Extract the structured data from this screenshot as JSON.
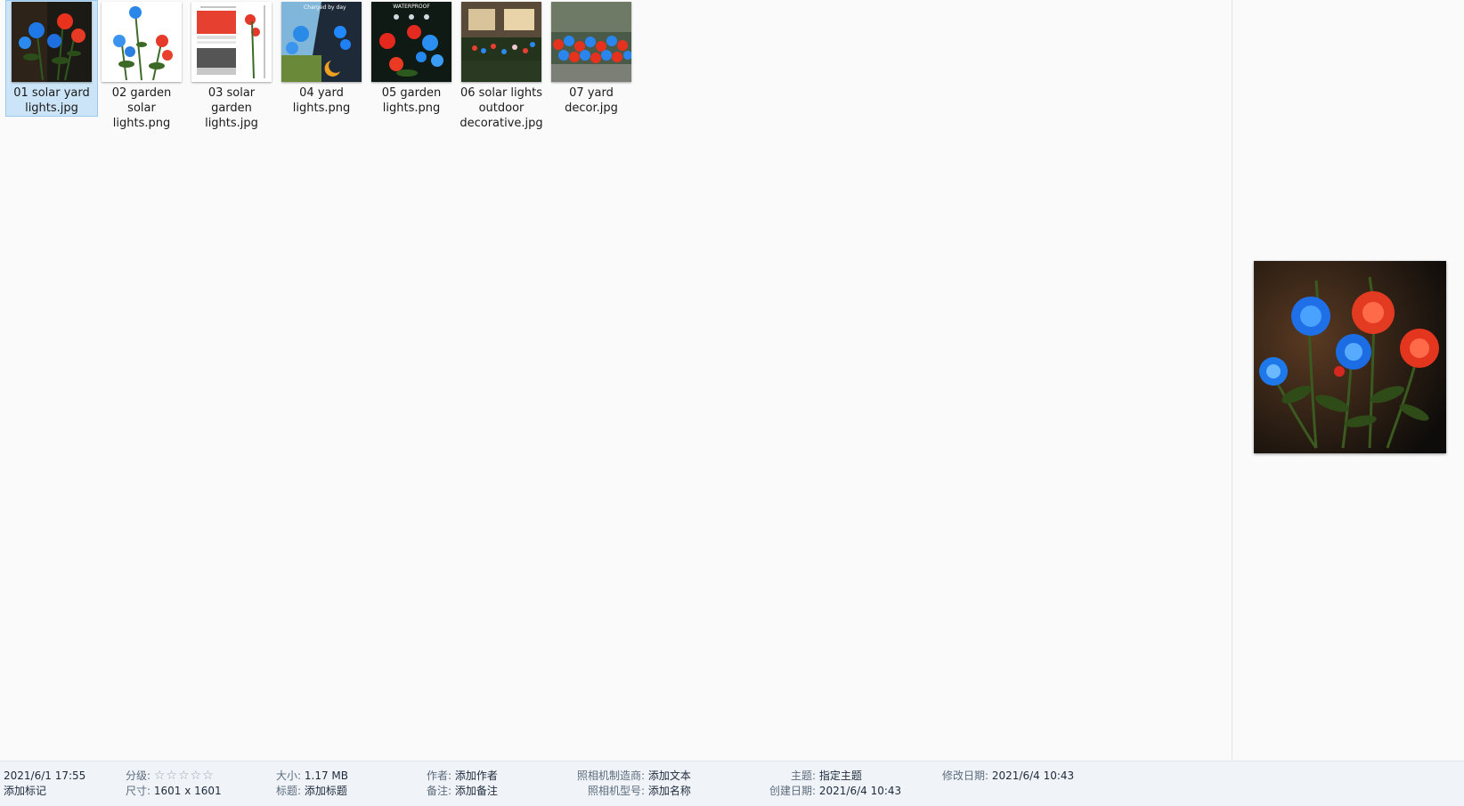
{
  "files": [
    {
      "name": "01 solar yard lights.jpg",
      "label_lines": [
        "01 solar yard",
        "lights.jpg"
      ],
      "selected": true,
      "thumb": "blue-red-roses-dark"
    },
    {
      "name": "02 garden solar lights.png",
      "label_lines": [
        "02 garden solar",
        "lights.png"
      ],
      "selected": false,
      "thumb": "roses-white-background"
    },
    {
      "name": "03 solar garden lights.jpg",
      "label_lines": [
        "03 solar garden",
        "lights.jpg"
      ],
      "selected": false,
      "thumb": "dimension-diagram"
    },
    {
      "name": "04 yard lights.png",
      "label_lines": [
        "04 yard",
        "lights.png"
      ],
      "selected": false,
      "thumb": "day-night-split",
      "thumb_text": "Charged by day"
    },
    {
      "name": "05 garden lights.png",
      "label_lines": [
        "05 garden",
        "lights.png"
      ],
      "selected": false,
      "thumb": "waterproof-roses",
      "thumb_text": "WATERPROOF"
    },
    {
      "name": "06 solar lights outdoor decorative.jpg",
      "label_lines": [
        "06 solar lights",
        "outdoor",
        "decorative.jpg"
      ],
      "selected": false,
      "thumb": "house-garden-night"
    },
    {
      "name": "07 yard decor.jpg",
      "label_lines": [
        "07 yard",
        "decor.jpg"
      ],
      "selected": false,
      "thumb": "rose-bed-field"
    }
  ],
  "preview": {
    "thumb": "blue-red-roses-dark"
  },
  "status": {
    "date_taken": "2021/6/1 17:55",
    "tags_link": "添加标记",
    "rating_label": "分级:",
    "rating_stars": "☆☆☆☆☆",
    "rating_value": 0,
    "dimensions_label": "尺寸:",
    "dimensions_value": "1601 x 1601",
    "size_label": "大小:",
    "size_value": "1.17 MB",
    "title_label": "标题:",
    "title_value": "添加标题",
    "author_label": "作者:",
    "author_value": "添加作者",
    "comments_label": "备注:",
    "comments_value": "添加备注",
    "camera_maker_label": "照相机制造商:",
    "camera_maker_value": "添加文本",
    "camera_model_label": "照相机型号:",
    "camera_model_value": "添加名称",
    "subject_label": "主题:",
    "subject_value": "指定主题",
    "created_label": "创建日期:",
    "created_value": "2021/6/4 10:43",
    "modified_label": "修改日期:",
    "modified_value": "2021/6/4 10:43"
  },
  "colors": {
    "selection_bg": "#cce4f7",
    "selection_border": "#99c9ef",
    "status_bg": "#f0f4f9",
    "rose_blue": "#1e78e6",
    "rose_red": "#e8321e"
  }
}
